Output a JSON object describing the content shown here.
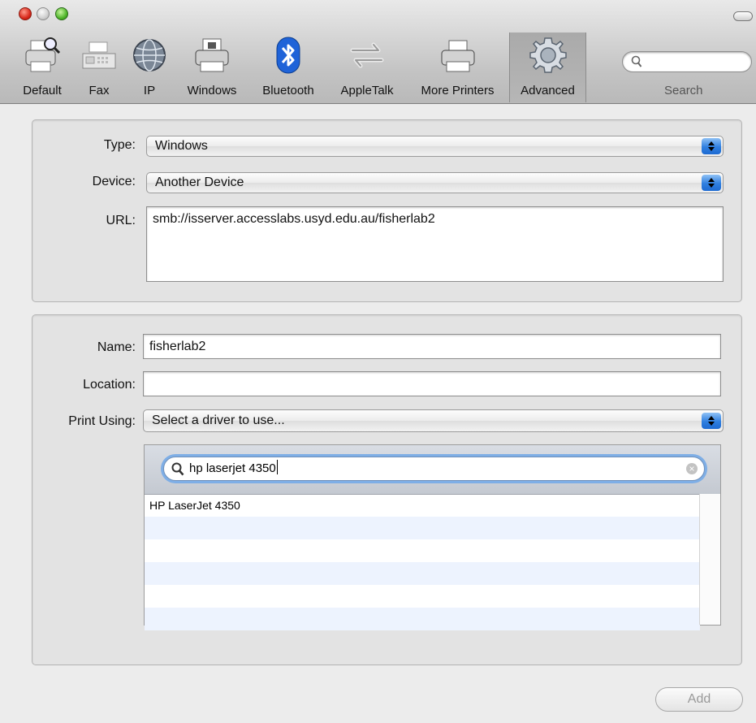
{
  "toolbar": {
    "items": [
      {
        "label": "Default",
        "icon": "printer-magnifier-icon"
      },
      {
        "label": "Fax",
        "icon": "fax-icon"
      },
      {
        "label": "IP",
        "icon": "globe-icon"
      },
      {
        "label": "Windows",
        "icon": "windows-printer-icon"
      },
      {
        "label": "Bluetooth",
        "icon": "bluetooth-icon"
      },
      {
        "label": "AppleTalk",
        "icon": "appletalk-arrows-icon"
      },
      {
        "label": "More Printers",
        "icon": "printer-icon"
      },
      {
        "label": "Advanced",
        "icon": "gear-icon"
      }
    ],
    "active": "Advanced",
    "search_label": "Search"
  },
  "connection": {
    "type_label": "Type:",
    "type_value": "Windows",
    "device_label": "Device:",
    "device_value": "Another Device",
    "url_label": "URL:",
    "url_value": "smb://isserver.accesslabs.usyd.edu.au/fisherlab2"
  },
  "printer": {
    "name_label": "Name:",
    "name_value": "fisherlab2",
    "location_label": "Location:",
    "location_value": "",
    "print_using_label": "Print Using:",
    "print_using_value": "Select a driver to use..."
  },
  "driver_search": {
    "value": "hp laserjet 4350",
    "results": [
      "HP LaserJet 4350",
      "",
      "",
      "",
      "",
      ""
    ]
  },
  "footer": {
    "add_label": "Add"
  },
  "colors": {
    "accent": "#2f7fe0",
    "focus_ring": "#7eaee6",
    "row_alt": "#edf3fe"
  }
}
